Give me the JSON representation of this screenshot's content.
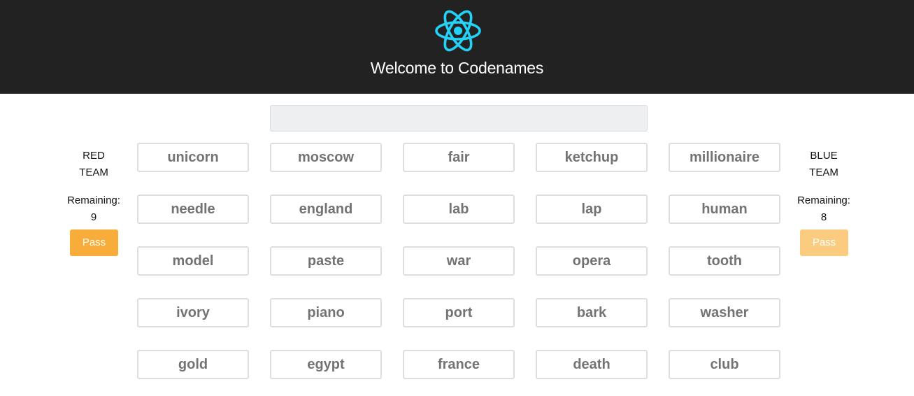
{
  "header": {
    "logo_icon": "react-atom-icon",
    "logo_color": "#22d3f7",
    "title": "Welcome to Codenames",
    "background": "#222222"
  },
  "clue": {
    "value": ""
  },
  "red_team": {
    "name": "RED TEAM",
    "remaining_label": "Remaining:",
    "remaining_count": "9",
    "pass_label": "Pass"
  },
  "blue_team": {
    "name": "BLUE TEAM",
    "remaining_label": "Remaining:",
    "remaining_count": "8",
    "pass_label": "Pass"
  },
  "board": {
    "rows": [
      [
        "unicorn",
        "moscow",
        "fair",
        "ketchup",
        "millionaire"
      ],
      [
        "needle",
        "england",
        "lab",
        "lap",
        "human"
      ],
      [
        "model",
        "paste",
        "war",
        "opera",
        "tooth"
      ],
      [
        "ivory",
        "piano",
        "port",
        "bark",
        "washer"
      ],
      [
        "gold",
        "egypt",
        "france",
        "death",
        "club"
      ]
    ]
  },
  "colors": {
    "pass_active": "#f8ac3a",
    "pass_faded": "#fbcb80",
    "card_border": "#dedede",
    "card_text": "#737373"
  }
}
